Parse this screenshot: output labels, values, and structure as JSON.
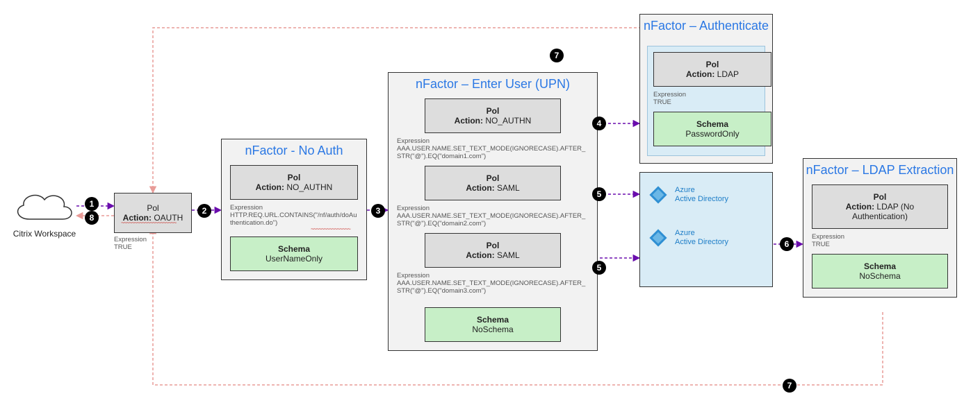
{
  "citrix": {
    "label": "Citrix Workspace"
  },
  "oauth": {
    "pol_label": "Pol",
    "action_prefix": "Action:",
    "action": "OAUTH",
    "expr_label": "Expression",
    "expr": "TRUE"
  },
  "noauth": {
    "title": "nFactor - No Auth",
    "pol_label": "Pol",
    "action_prefix": "Action:",
    "action": "NO_AUTHN",
    "expr_label": "Expression",
    "expr": "HTTP.REQ.URL.CONTAINS(\"/nf/auth/doAuthentication.do\")",
    "schema_label": "Schema",
    "schema": "UserNameOnly"
  },
  "upn": {
    "title": "nFactor – Enter User (UPN)",
    "pol_label": "Pol",
    "action_prefix": "Action:",
    "p1_action": "NO_AUTHN",
    "p1_expr_label": "Expression",
    "p1_expr": "AAA.USER.NAME.SET_TEXT_MODE(IGNORECASE).AFTER_STR(\"@\").EQ(\"domain1.com\")",
    "p2_action": "SAML",
    "p2_expr_label": "Expression",
    "p2_expr": "AAA.USER.NAME.SET_TEXT_MODE(IGNORECASE).AFTER_STR(\"@\").EQ(\"domain2.com\")",
    "p3_action": "SAML",
    "p3_expr_label": "Expression",
    "p3_expr": "AAA.USER.NAME.SET_TEXT_MODE(IGNORECASE).AFTER_STR(\"@\").EQ(\"domain3.com\")",
    "schema_label": "Schema",
    "schema": "NoSchema"
  },
  "auth": {
    "title": "nFactor – Authenticate",
    "pol_label": "Pol",
    "action_prefix": "Action:",
    "action": "LDAP",
    "expr_label": "Expression",
    "expr": "TRUE",
    "schema_label": "Schema",
    "schema": "PasswordOnly"
  },
  "azure": {
    "line1": "Azure",
    "line2": "Active Directory"
  },
  "ldapx": {
    "title": "nFactor – LDAP Extraction",
    "pol_label": "Pol",
    "action_prefix": "Action:",
    "action": "LDAP (No Authentication)",
    "expr_label": "Expression",
    "expr": "TRUE",
    "schema_label": "Schema",
    "schema": "NoSchema"
  },
  "steps": {
    "s1": "1",
    "s2": "2",
    "s3": "3",
    "s4": "4",
    "s5a": "5",
    "s5b": "5",
    "s6": "6",
    "s7a": "7",
    "s7b": "7",
    "s8": "8"
  }
}
